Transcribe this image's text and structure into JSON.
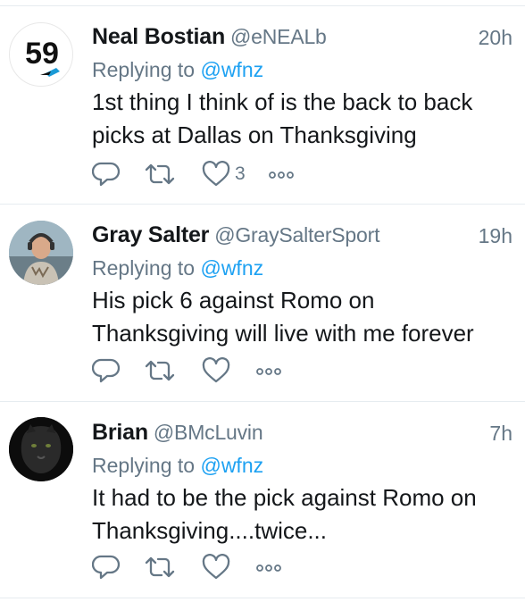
{
  "colors": {
    "accent": "#1da1f2",
    "secondary": "#657786",
    "text": "#14171a",
    "border": "#e6ecf0"
  },
  "replying_prefix": "Replying to",
  "tweets": [
    {
      "name": "Neal Bostian",
      "handle": "@eNEALb",
      "time": "20h",
      "replying_to": "@wfnz",
      "text_line1": "1st thing I think of is the back to back",
      "text_line2": "picks at Dallas on Thanksgiving",
      "like_count": "3",
      "avatar_text": "59",
      "avatar_icon": "jersey-59-avatar"
    },
    {
      "name": "Gray Salter",
      "handle": "@GraySalterSport",
      "time": "19h",
      "replying_to": "@wfnz",
      "text_line1": "His pick 6 against Romo on",
      "text_line2": "Thanksgiving will live with me forever",
      "like_count": "",
      "avatar_icon": "person-with-headset-avatar"
    },
    {
      "name": "Brian",
      "handle": "@BMcLuvin",
      "time": "7h",
      "replying_to": "@wfnz",
      "text_line1": "It had to be the pick against Romo on",
      "text_line2": "Thanksgiving....twice...",
      "like_count": "",
      "avatar_icon": "black-panther-avatar"
    }
  ]
}
